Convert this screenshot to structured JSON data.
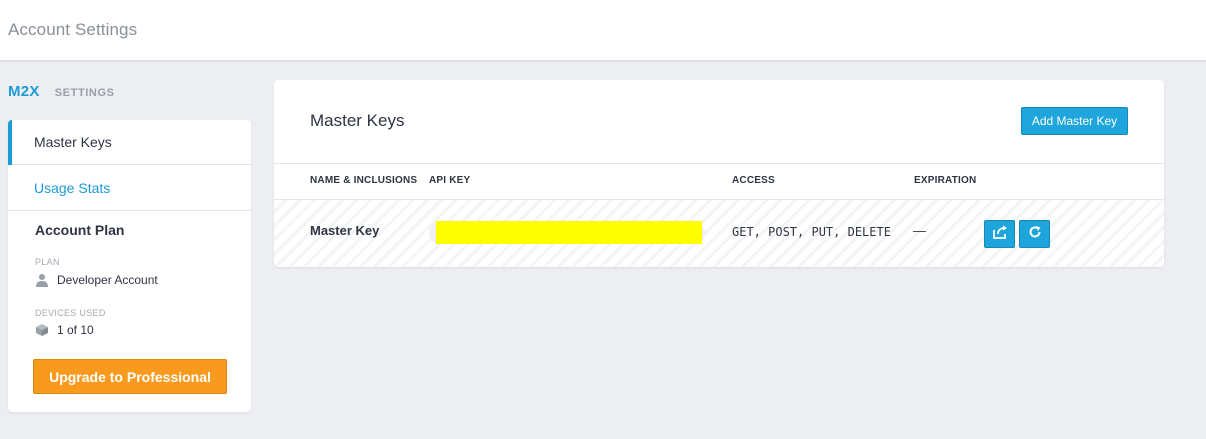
{
  "header": {
    "title": "Account Settings"
  },
  "sidebar": {
    "brand": "M2X",
    "section_label": "SETTINGS",
    "items": [
      {
        "label": "Master Keys",
        "active": true
      },
      {
        "label": "Usage Stats",
        "active": false
      }
    ],
    "account_plan": {
      "heading": "Account Plan",
      "plan_label": "PLAN",
      "plan_value": "Developer Account",
      "plan_icon": "user-icon",
      "devices_label": "DEVICES USED",
      "devices_value": "1 of 10",
      "devices_icon": "cube-icon",
      "upgrade_label": "Upgrade to Professional"
    }
  },
  "main": {
    "title": "Master Keys",
    "add_button_label": "Add Master Key",
    "columns": [
      "NAME & INCLUSIONS",
      "API KEY",
      "ACCESS",
      "EXPIRATION"
    ],
    "rows": [
      {
        "name": "Master Key",
        "api_key": "",
        "access": "GET, POST, PUT, DELETE",
        "expiration": "—",
        "actions": [
          "share-icon",
          "refresh-icon"
        ]
      }
    ]
  },
  "colors": {
    "accent": "#1e9bd7",
    "button_blue": "#1ea6dc",
    "upgrade_orange": "#f79a1e",
    "redaction": "#ffff00",
    "background": "#eceef2"
  }
}
